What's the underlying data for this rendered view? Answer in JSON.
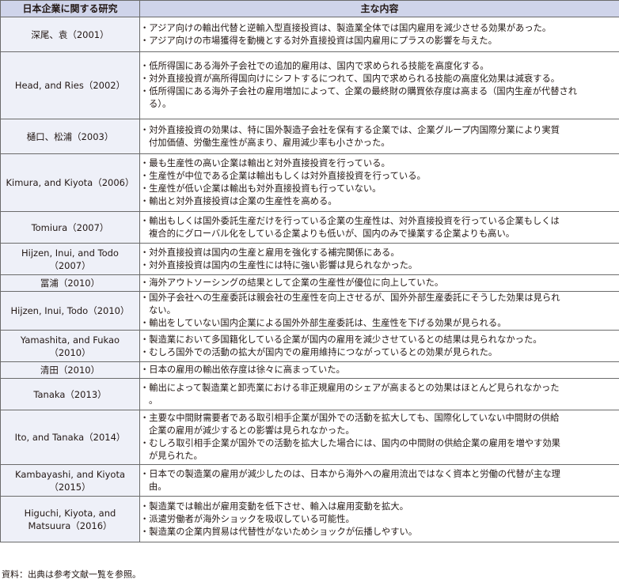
{
  "table": {
    "headers": [
      "日本企業に関する研究",
      "主な内容"
    ],
    "rows": [
      {
        "study": [
          "深尾、袁（2001）"
        ],
        "content": [
          "・アジア向けの輸出代替と逆輸入型直接投資は、製造業全体では国内雇用を減少させる効果があった。",
          "・アジア向けの市場獲得を動機とする対外直接投資は国内雇用にプラスの影響を与えた。"
        ]
      },
      {
        "study": [
          "Head, and Ries（2002）"
        ],
        "content": [
          "・低所得国にある海外子会社での追加的雇用は、国内で求められる技能を高度化する。",
          "・対外直接投資が高所得国向けにシフトするにつれて、国内で求められる技能の高度化効果は減衰する。",
          "・低所得国にある海外子会社の雇用増加によって、企業の最終財の購買依存度は高まる（国内生産が代替される）。"
        ]
      },
      {
        "study": [
          "樋口、松浦（2003）"
        ],
        "content": [
          "・対外直接投資の効果は、特に国外製造子会社を保有する企業では、企業グループ内国際分業により実質付加価値、労働生産性が高まり、雇用減少率も小さかった。"
        ]
      },
      {
        "study": [
          "Kimura, and Kiyota（2006）"
        ],
        "content": [
          "・最も生産性の高い企業は輸出と対外直接投資を行っている。",
          "・生産性が中位である企業は輸出もしくは対外直接投資を行っている。",
          "・生産性が低い企業は輸出も対外直接投資も行っていない。",
          "・輸出と対外直接投資は企業の生産性を高める。"
        ]
      },
      {
        "study": [
          "Tomiura（2007）"
        ],
        "content": [
          "・輸出もしくは国外委託生産だけを行っている企業の生産性は、対外直接投資を行っている企業もしくは複合的にグローバル化をしている企業よりも低いが、国内のみで操業する企業よりも高い。"
        ]
      },
      {
        "study": [
          "Hijzen, Inui, and Todo",
          "（2007）"
        ],
        "content": [
          "・対外直接投資は国内の生産と雇用を強化する補完関係にある。",
          "・対外直接投資は国内の生産性には特に強い影響は見られなかった。"
        ]
      },
      {
        "study": [
          "冨浦（2010）"
        ],
        "content": [
          "・海外アウトソーシングの結果として企業の生産性が優位に向上していた。"
        ]
      },
      {
        "study": [
          "Hijzen, Inui, Todo（2010）"
        ],
        "content": [
          "・国外子会社への生産委託は親会社の生産性を向上させるが、国外外部生産委託にそうした効果は見られない。",
          "・輸出をしていない国内企業による国外外部生産委託は、生産性を下げる効果が見られる。"
        ]
      },
      {
        "study": [
          "Yamashita, and Fukao",
          "（2010）"
        ],
        "content": [
          "・製造業において多国籍化している企業が国内の雇用を減少させているとの結果は見られなかった。",
          "・むしろ国外での活動の拡大が国内での雇用維持につながっているとの効果が見られた。"
        ]
      },
      {
        "study": [
          "清田（2010）"
        ],
        "content": [
          "・日本の雇用の輸出依存度は徐々に高まっていた。"
        ]
      },
      {
        "study": [
          "Tanaka（2013）"
        ],
        "content": [
          "・輸出によって製造業と卸売業における非正規雇用のシェアが高まるとの効果はほとんど見られなかった。"
        ]
      },
      {
        "study": [
          "Ito, and Tanaka（2014）"
        ],
        "content": [
          "・主要な中間財需要者である取引相手企業が国外での活動を拡大しても、国際化していない中間財の供給企業の雇用が減少するとの影響は見られなかった。",
          "・むしろ取引相手企業が国外での活動を拡大した場合には、国内の中間財の供給企業の雇用を増やす効果が見られた。"
        ]
      },
      {
        "study": [
          "Kambayashi, and Kiyota",
          "（2015）"
        ],
        "content": [
          "・日本での製造業の雇用が減少したのは、日本から海外への雇用流出ではなく資本と労働の代替が主な理由。"
        ]
      },
      {
        "study": [
          "Higuchi, Kiyota, and",
          "Matsuura（2016）"
        ],
        "content": [
          "・製造業では輸出が雇用変動を低下させ、輸入は雇用変動を拡大。",
          "・派遣労働者が海外ショックを吸収している可能性。",
          "・製造業の企業内貿易は代替性がないためショックが伝播しやすい。"
        ]
      }
    ]
  },
  "source": "資料：出典は参考文献一覧を参照。"
}
